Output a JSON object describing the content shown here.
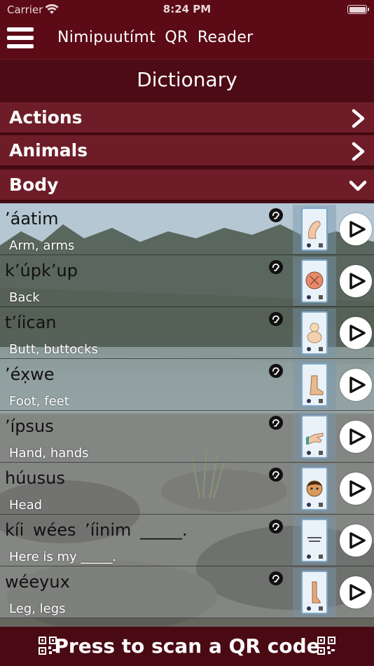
{
  "status_bar": {
    "carrier": "Carrier",
    "time": "8:24 PM",
    "wifi_icon": "wifi-icon",
    "battery_icon": "battery-icon",
    "battery_level": 1.0
  },
  "nav_bar": {
    "menu_icon": "hamburger-menu-icon",
    "title": "Nimipuutímt QR Reader"
  },
  "page": {
    "title": "Dictionary"
  },
  "categories": [
    {
      "label": "Actions",
      "icon": "chevron-right-icon",
      "expanded": false
    },
    {
      "label": "Animals",
      "icon": "chevron-right-icon",
      "expanded": false
    },
    {
      "label": "Body",
      "icon": "chevron-down-icon",
      "expanded": true
    }
  ],
  "entries": [
    {
      "word": "’áatim",
      "translation": "Arm, arms",
      "card_picture": "arm"
    },
    {
      "word": "k’úpk’up",
      "translation": "Back",
      "card_picture": "back"
    },
    {
      "word": "t’íican",
      "translation": "Butt, buttocks",
      "card_picture": "butt"
    },
    {
      "word": "’éx̣we",
      "translation": "Foot, feet",
      "card_picture": "foot"
    },
    {
      "word": "’ípsus",
      "translation": "Hand, hands",
      "card_picture": "hand"
    },
    {
      "word": "húusus",
      "translation": "Head",
      "card_picture": "head"
    },
    {
      "word": "kíi wées ’íinim _____.",
      "translation": "Here is my _____.",
      "card_picture": "text"
    },
    {
      "word": "wéeyux",
      "translation": "Leg, legs",
      "card_picture": "leg"
    }
  ],
  "row_icons": {
    "audio": "audio-ear-icon",
    "play": "play-icon",
    "card": "flashcard-thumbnail"
  },
  "scan_bar": {
    "label": "Press to scan a QR code",
    "icon": "qr-code-icon"
  },
  "colors": {
    "bar_background": "#5b0a16",
    "category_background": "#6e1d28",
    "text_white": "#ffffff",
    "word_text": "#111111"
  }
}
